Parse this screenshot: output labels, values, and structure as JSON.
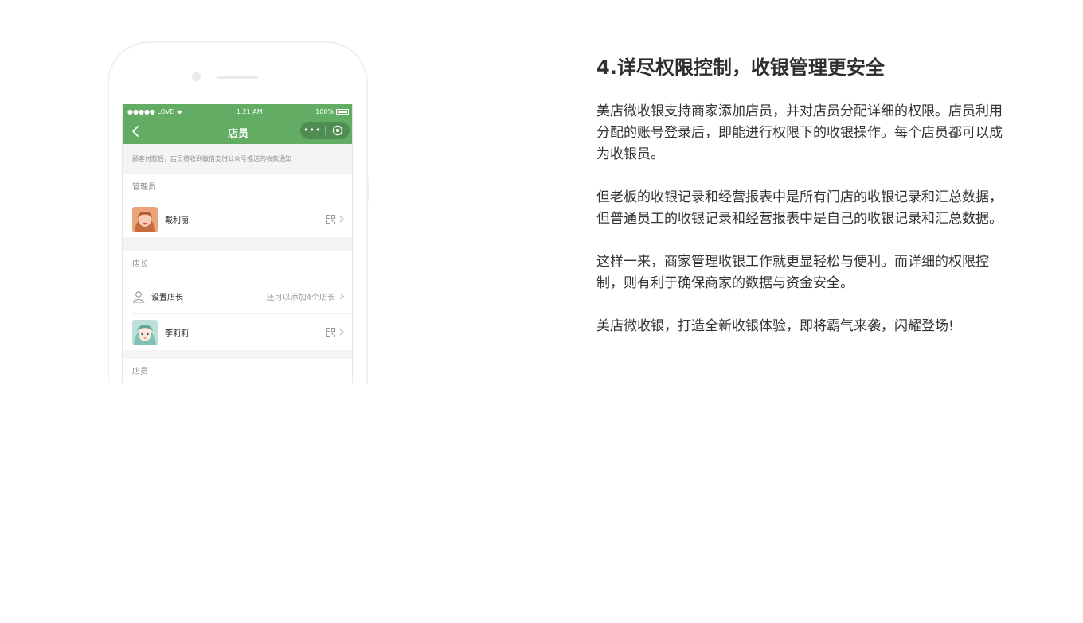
{
  "phone": {
    "status_bar": {
      "carrier": "●●●●● LOVE",
      "time": "1:21 AM",
      "battery": "100%"
    },
    "nav": {
      "title": "店员",
      "more_icon": "more-dots-icon",
      "close_icon": "target-circle-icon"
    },
    "notice": "顾客付款后，店员将收到微信支付公众号推送的收款通知",
    "sections": {
      "admin": {
        "title": "管理员",
        "member_name": "戴利丽"
      },
      "manager": {
        "title": "店长",
        "set_label": "设置店长",
        "set_hint": "还可以添加4个店长",
        "member_name": "李莉莉"
      },
      "staff": {
        "title": "店员"
      }
    },
    "colors": {
      "accent": "#62ad63"
    }
  },
  "article": {
    "heading": "4.详尽权限控制，收银管理更安全",
    "paragraphs": [
      "美店微收银支持商家添加店员，并对店员分配详细的权限。店员利用分配的账号登录后，即能进行权限下的收银操作。每个店员都可以成为收银员。",
      "但老板的收银记录和经营报表中是所有门店的收银记录和汇总数据，但普通员工的收银记录和经营报表中是自己的收银记录和汇总数据。",
      "这样一来，商家管理收银工作就更显轻松与便利。而详细的权限控制，则有利于确保商家的数据与资金安全。",
      "美店微收银，打造全新收银体验，即将霸气来袭，闪耀登场!"
    ]
  }
}
